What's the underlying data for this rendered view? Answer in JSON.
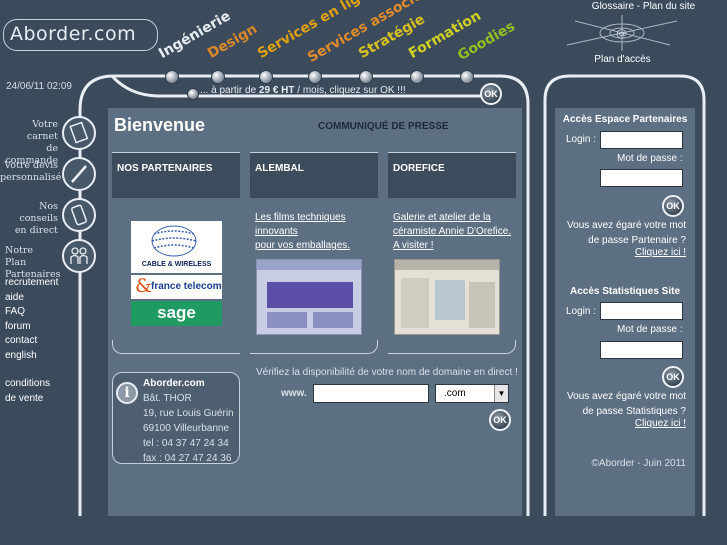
{
  "header": {
    "logo_text": "Aborder.com",
    "glossary_links": "Glossaire - Plan du site",
    "access_plan": "Plan d'accès",
    "date": "24/06/11 02:09"
  },
  "top_nav": [
    {
      "label": "Ingénierie",
      "color": "#e8ecf0"
    },
    {
      "label": "Design",
      "color": "#d9882a"
    },
    {
      "label": "Services en ligne",
      "color": "#e0a010"
    },
    {
      "label": "Services associés",
      "color": "#e08a2a"
    },
    {
      "label": "Stratégie",
      "color": "#d8c020"
    },
    {
      "label": "Formation",
      "color": "#cfd020"
    },
    {
      "label": "Goodies",
      "color": "#8fbf20"
    }
  ],
  "ticker": {
    "prefix": "... à partir de ",
    "price": "29 € HT",
    "suffix": " / mois, cliquez sur OK !!!"
  },
  "side_nav": [
    {
      "label_line1": "Votre carnet",
      "label_line2": "de commande",
      "icon": "notebook-icon"
    },
    {
      "label_line1": "Votre devis",
      "label_line2": "personnalisé",
      "icon": "pen-icon"
    },
    {
      "label_line1": "Nos conseils",
      "label_line2": "en direct",
      "icon": "phone-icon"
    },
    {
      "label_line1": "Notre Plan",
      "label_line2": "Partenaires",
      "icon": "people-icon"
    }
  ],
  "left_menu": [
    "recrutement",
    "aide",
    "FAQ",
    "forum",
    "contact",
    "english"
  ],
  "conditions": [
    "conditions",
    "de vente"
  ],
  "main": {
    "welcome": "Bienvenue",
    "press": "COMMUNIQUÉ DE PRESSE",
    "columns": [
      {
        "title": "NOS PARTENAIRES"
      },
      {
        "title": "ALEMBAL",
        "text_lines": [
          "Les films techniques",
          "innovants",
          "pour vos emballages."
        ]
      },
      {
        "title": "DOREFICE",
        "text_lines": [
          "Galerie et atelier de la",
          "céramiste Annie D'Orefice.",
          "A visiter !"
        ]
      }
    ],
    "partners": [
      "CABLE & WIRELESS",
      "france telecom",
      "sage"
    ],
    "contact": {
      "name": "Aborder.com",
      "lines": [
        "Bât. THOR",
        "19, rue Louis Guérin",
        "69100 Villeurbanne",
        "tel : 04 37 47 24 34",
        "fax : 04 27 47 24 36"
      ]
    },
    "domain": {
      "prompt": "Vérifiez la disponibilité de votre nom de domaine en direct !",
      "prefix": "www.",
      "value": "",
      "tld": ".com",
      "ok": "OK"
    }
  },
  "partner_area": {
    "title": "Accès Espace Partenaires",
    "login_label": "Login :",
    "password_label": "Mot de passe :",
    "ok": "OK",
    "forgot_line1": "Vous avez égaré votre mot",
    "forgot_line2": "de passe Partenaire ?",
    "forgot_link": "Cliquez ici !"
  },
  "stats_area": {
    "title": "Accès Statistiques Site",
    "login_label": "Login :",
    "password_label": "Mot de passe :",
    "ok": "OK",
    "forgot_line1": "Vous avez égaré votre mot",
    "forgot_line2": "de passe Statistiques ?",
    "forgot_link": "Cliquez ici !"
  },
  "copyright": "©Aborder - Juin 2011",
  "ticker_ok": "OK"
}
